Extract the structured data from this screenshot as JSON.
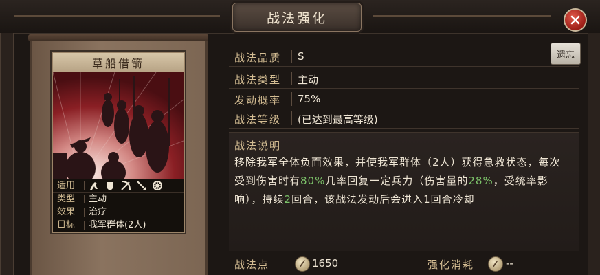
{
  "header": {
    "title": "战法强化"
  },
  "card": {
    "name": "草船借箭",
    "info": [
      {
        "key": "适用",
        "value": ""
      },
      {
        "key": "类型",
        "value": "主动"
      },
      {
        "key": "效果",
        "value": "治疗"
      },
      {
        "key": "目标",
        "value": "我军群体(2人)"
      }
    ],
    "unit_icons": [
      "cavalry-icon",
      "shield-icon",
      "crossbow-icon",
      "spear-icon",
      "wheel-icon"
    ]
  },
  "details": {
    "rows": [
      {
        "label": "战法品质",
        "value": "S"
      },
      {
        "label": "战法类型",
        "value": "主动"
      },
      {
        "label": "发动概率",
        "value": "75%"
      },
      {
        "label": "战法等级",
        "value": "(已达到最高等级)"
      }
    ],
    "forget_label": "遗忘",
    "description_title": "战法说明",
    "description": {
      "p1": "移除我军全体负面效果，并使我军群体（2人）获得急救状态，每次受到伤害时有",
      "h1": "80%",
      "p2": "几率回复一定兵力（伤害量的",
      "h2": "28%",
      "p3": "，受统率影响），持续",
      "h3": "2",
      "p4": "回合，该战法发动后会进入1回合冷却"
    }
  },
  "costs": {
    "points_label": "战法点",
    "points_value": "1650",
    "consume_label": "强化消耗",
    "consume_value": "--"
  },
  "colors": {
    "highlight": "#7cc26a",
    "label": "#d4bd93",
    "close": "#c23228"
  }
}
